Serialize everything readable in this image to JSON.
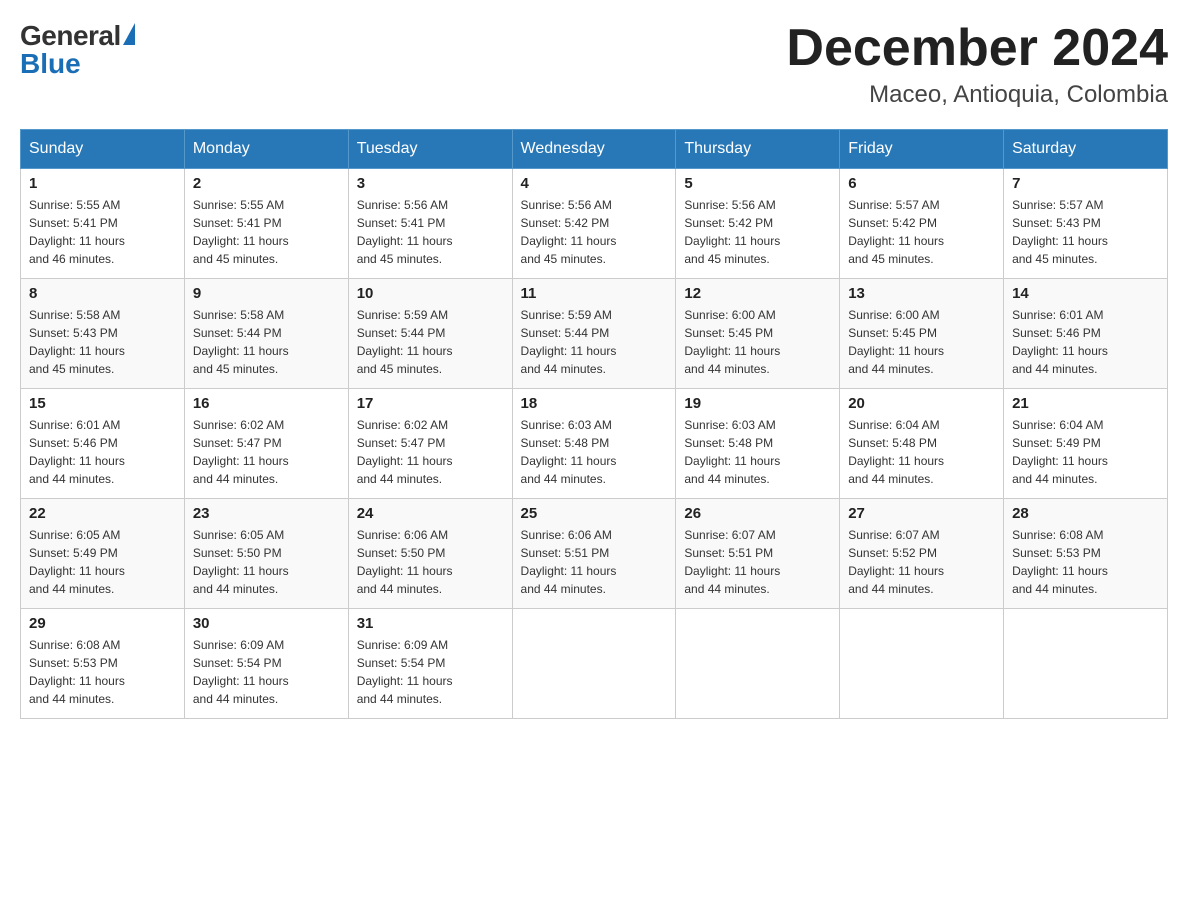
{
  "logo": {
    "general_text": "General",
    "blue_text": "Blue"
  },
  "header": {
    "month_year": "December 2024",
    "location": "Maceo, Antioquia, Colombia"
  },
  "weekdays": [
    "Sunday",
    "Monday",
    "Tuesday",
    "Wednesday",
    "Thursday",
    "Friday",
    "Saturday"
  ],
  "weeks": [
    [
      {
        "day": "1",
        "sunrise": "5:55 AM",
        "sunset": "5:41 PM",
        "daylight": "11 hours and 46 minutes."
      },
      {
        "day": "2",
        "sunrise": "5:55 AM",
        "sunset": "5:41 PM",
        "daylight": "11 hours and 45 minutes."
      },
      {
        "day": "3",
        "sunrise": "5:56 AM",
        "sunset": "5:41 PM",
        "daylight": "11 hours and 45 minutes."
      },
      {
        "day": "4",
        "sunrise": "5:56 AM",
        "sunset": "5:42 PM",
        "daylight": "11 hours and 45 minutes."
      },
      {
        "day": "5",
        "sunrise": "5:56 AM",
        "sunset": "5:42 PM",
        "daylight": "11 hours and 45 minutes."
      },
      {
        "day": "6",
        "sunrise": "5:57 AM",
        "sunset": "5:42 PM",
        "daylight": "11 hours and 45 minutes."
      },
      {
        "day": "7",
        "sunrise": "5:57 AM",
        "sunset": "5:43 PM",
        "daylight": "11 hours and 45 minutes."
      }
    ],
    [
      {
        "day": "8",
        "sunrise": "5:58 AM",
        "sunset": "5:43 PM",
        "daylight": "11 hours and 45 minutes."
      },
      {
        "day": "9",
        "sunrise": "5:58 AM",
        "sunset": "5:44 PM",
        "daylight": "11 hours and 45 minutes."
      },
      {
        "day": "10",
        "sunrise": "5:59 AM",
        "sunset": "5:44 PM",
        "daylight": "11 hours and 45 minutes."
      },
      {
        "day": "11",
        "sunrise": "5:59 AM",
        "sunset": "5:44 PM",
        "daylight": "11 hours and 44 minutes."
      },
      {
        "day": "12",
        "sunrise": "6:00 AM",
        "sunset": "5:45 PM",
        "daylight": "11 hours and 44 minutes."
      },
      {
        "day": "13",
        "sunrise": "6:00 AM",
        "sunset": "5:45 PM",
        "daylight": "11 hours and 44 minutes."
      },
      {
        "day": "14",
        "sunrise": "6:01 AM",
        "sunset": "5:46 PM",
        "daylight": "11 hours and 44 minutes."
      }
    ],
    [
      {
        "day": "15",
        "sunrise": "6:01 AM",
        "sunset": "5:46 PM",
        "daylight": "11 hours and 44 minutes."
      },
      {
        "day": "16",
        "sunrise": "6:02 AM",
        "sunset": "5:47 PM",
        "daylight": "11 hours and 44 minutes."
      },
      {
        "day": "17",
        "sunrise": "6:02 AM",
        "sunset": "5:47 PM",
        "daylight": "11 hours and 44 minutes."
      },
      {
        "day": "18",
        "sunrise": "6:03 AM",
        "sunset": "5:48 PM",
        "daylight": "11 hours and 44 minutes."
      },
      {
        "day": "19",
        "sunrise": "6:03 AM",
        "sunset": "5:48 PM",
        "daylight": "11 hours and 44 minutes."
      },
      {
        "day": "20",
        "sunrise": "6:04 AM",
        "sunset": "5:48 PM",
        "daylight": "11 hours and 44 minutes."
      },
      {
        "day": "21",
        "sunrise": "6:04 AM",
        "sunset": "5:49 PM",
        "daylight": "11 hours and 44 minutes."
      }
    ],
    [
      {
        "day": "22",
        "sunrise": "6:05 AM",
        "sunset": "5:49 PM",
        "daylight": "11 hours and 44 minutes."
      },
      {
        "day": "23",
        "sunrise": "6:05 AM",
        "sunset": "5:50 PM",
        "daylight": "11 hours and 44 minutes."
      },
      {
        "day": "24",
        "sunrise": "6:06 AM",
        "sunset": "5:50 PM",
        "daylight": "11 hours and 44 minutes."
      },
      {
        "day": "25",
        "sunrise": "6:06 AM",
        "sunset": "5:51 PM",
        "daylight": "11 hours and 44 minutes."
      },
      {
        "day": "26",
        "sunrise": "6:07 AM",
        "sunset": "5:51 PM",
        "daylight": "11 hours and 44 minutes."
      },
      {
        "day": "27",
        "sunrise": "6:07 AM",
        "sunset": "5:52 PM",
        "daylight": "11 hours and 44 minutes."
      },
      {
        "day": "28",
        "sunrise": "6:08 AM",
        "sunset": "5:53 PM",
        "daylight": "11 hours and 44 minutes."
      }
    ],
    [
      {
        "day": "29",
        "sunrise": "6:08 AM",
        "sunset": "5:53 PM",
        "daylight": "11 hours and 44 minutes."
      },
      {
        "day": "30",
        "sunrise": "6:09 AM",
        "sunset": "5:54 PM",
        "daylight": "11 hours and 44 minutes."
      },
      {
        "day": "31",
        "sunrise": "6:09 AM",
        "sunset": "5:54 PM",
        "daylight": "11 hours and 44 minutes."
      },
      null,
      null,
      null,
      null
    ]
  ],
  "labels": {
    "sunrise": "Sunrise:",
    "sunset": "Sunset:",
    "daylight": "Daylight:"
  }
}
